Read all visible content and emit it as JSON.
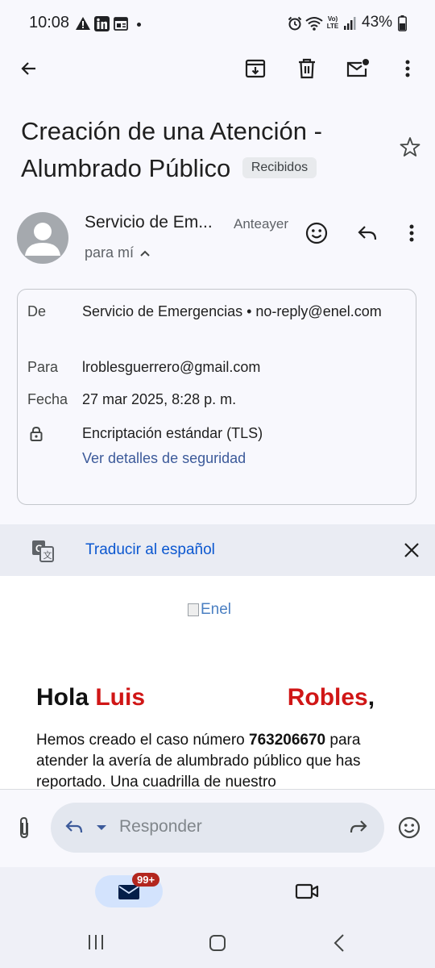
{
  "status_bar": {
    "time": "10:08",
    "battery": "43%"
  },
  "toolbar": {
    "back_icon": "arrow-left-icon",
    "archive_icon": "archive-icon",
    "delete_icon": "trash-icon",
    "unread_icon": "mark-unread-icon",
    "more_icon": "more-vert-icon"
  },
  "email": {
    "subject": "Creación de una Atención - Alumbrado Público",
    "label": "Recibidos",
    "sender_name": "Servicio de Emergencias",
    "sender_short": "Servicio de Em...",
    "date_short": "Anteayer",
    "to_me": "para mí",
    "details": {
      "from_label": "De",
      "from_value": "Servicio de Emergencias • no-reply@enel.com",
      "to_label": "Para",
      "to_value": "lroblesguerrero@gmail.com",
      "date_label": "Fecha",
      "date_value": "27 mar 2025, 8:28 p. m.",
      "encryption": "Encriptación estándar (TLS)",
      "security_link": "Ver detalles de seguridad"
    }
  },
  "translate": {
    "text": "Traducir al español"
  },
  "body": {
    "logo_alt": "Enel",
    "greeting_hola": "Hola",
    "greeting_first": "Luis",
    "greeting_last": "Robles",
    "greeting_comma": ",",
    "text_before": "Hemos creado el caso número ",
    "case_number": "763206670",
    "text_after": " para atender la avería de alumbrado público que has reportado. Una cuadrilla de nuestro"
  },
  "reply": {
    "placeholder": "Responder"
  },
  "bottom_nav": {
    "badge": "99+"
  },
  "colors": {
    "accent": "#0b57d0",
    "greeting_red": "#d01616",
    "badge": "#b3261e"
  }
}
